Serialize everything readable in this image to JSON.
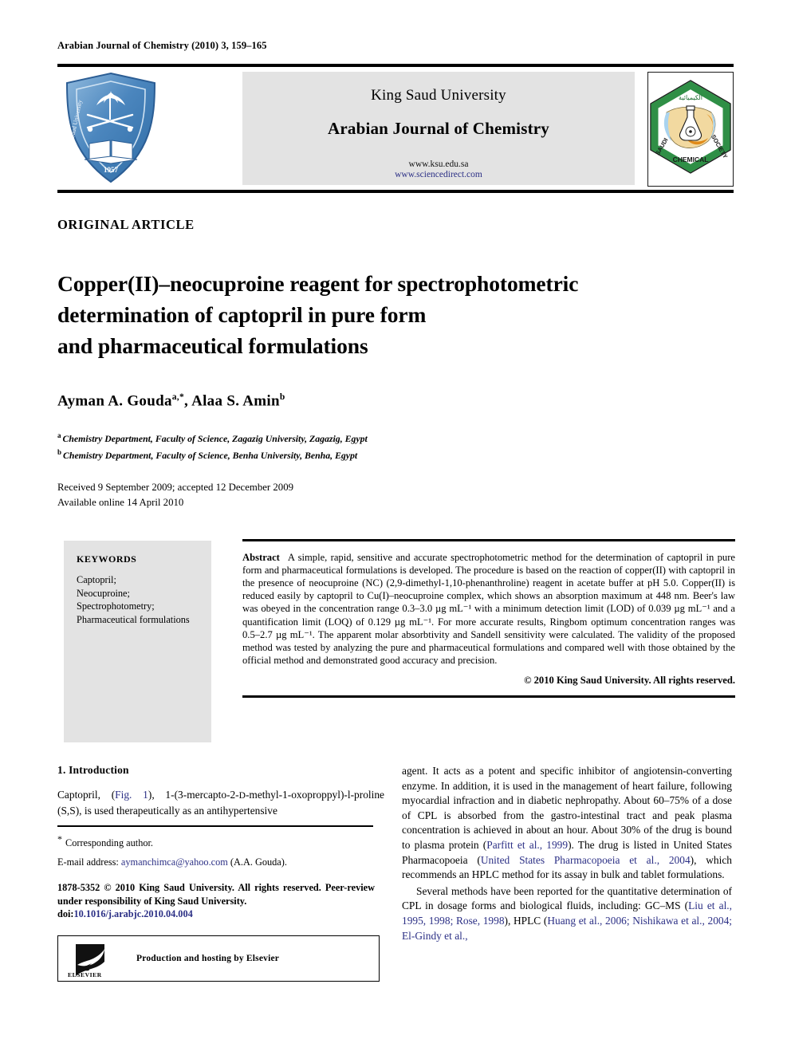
{
  "running_head": "Arabian Journal of Chemistry (2010) 3, 159–165",
  "masthead": {
    "publisher": "King Saud University",
    "journal": "Arabian Journal of Chemistry",
    "url_ksu": "www.ksu.edu.sa",
    "url_sciencedirect": "www.sciencedirect.com",
    "left_logo_name": "King Saud University",
    "left_logo_year": "1957",
    "right_logo_line1": "SAUDI",
    "right_logo_line2": "SOCIETY",
    "right_logo_line3": "CHEMICAL",
    "right_logo_arabic": "الكيميائية",
    "colors": {
      "panel_bg": "#e3e3e3",
      "ksu_blue": "#2f6fb5",
      "scs_green": "#2f8f46",
      "link_blue": "#2b2f85"
    }
  },
  "article_type": "ORIGINAL ARTICLE",
  "title": {
    "line1": "Copper(II)–neocuproine reagent for spectrophotometric",
    "line2": "determination of captopril in pure form",
    "line3": "and pharmaceutical formulations"
  },
  "authors": {
    "full": "Ayman A. Gouda",
    "marker1": "a,*",
    "second": ", Alaa S. Amin",
    "marker2": "b"
  },
  "affiliations": [
    {
      "marker": "a",
      "text": "Chemistry Department, Faculty of Science, Zagazig University, Zagazig, Egypt"
    },
    {
      "marker": "b",
      "text": "Chemistry Department, Faculty of Science, Benha University, Benha, Egypt"
    }
  ],
  "dates": {
    "received": "Received 9 September 2009; accepted 12 December 2009",
    "available": "Available online 14 April 2010"
  },
  "keywords": {
    "heading": "KEYWORDS",
    "items": "Captopril;\nNeocuproine;\nSpectrophotometry;\nPharmaceutical formulations"
  },
  "abstract": {
    "label": "Abstract",
    "text": "A simple, rapid, sensitive and accurate spectrophotometric method for the determination of captopril in pure form and pharmaceutical formulations is developed. The procedure is based on the reaction of copper(II) with captopril in the presence of neocuproine (NC) (2,9-dimethyl-1,10-phenanthroline) reagent in acetate buffer at pH 5.0. Copper(II) is reduced easily by captopril to Cu(I)–neocuproine complex, which shows an absorption maximum at 448 nm. Beer's law was obeyed in the concentration range 0.3–3.0 µg mL⁻¹ with a minimum detection limit (LOD) of 0.039 µg mL⁻¹ and a quantification limit (LOQ) of 0.129 µg mL⁻¹. For more accurate results, Ringbom optimum concentration ranges was 0.5–2.7 µg mL⁻¹. The apparent molar absorbtivity and Sandell sensitivity were calculated. The validity of the proposed method was tested by analyzing the pure and pharmaceutical formulations and compared well with those obtained by the official method and demonstrated good accuracy and precision.",
    "copyright": "© 2010 King Saud University. All rights reserved."
  },
  "body": {
    "section_heading": "1. Introduction",
    "left_para_1_pre": "Captopril, (",
    "left_para_1_link": "Fig. 1",
    "left_para_1_post": "), 1-(3-mercapto-2-",
    "left_para_1_smallcap": "D",
    "left_para_1_post2": "-methyl-1-oxoproppyl)-l-proline (S,S), is used therapeutically as an antihypertensive",
    "footnote_corresponding": "Corresponding author.",
    "footnote_email_label": "E-mail address:",
    "footnote_email": "aymanchimca@yahoo.com",
    "footnote_email_post": "(A.A. Gouda).",
    "issn_line": "1878-5352 © 2010 King Saud University. All rights reserved. Peer-review under responsibility of King Saud University.",
    "doi_label": "doi:",
    "doi_value": "10.1016/j.arabjc.2010.04.004",
    "elsevier_text": "Production and hosting by Elsevier",
    "elsevier_word": "ELSEVIER",
    "right_para_1": "agent. It acts as a potent and specific inhibitor of angiotensin-converting enzyme. In addition, it is used in the management of heart failure, following myocardial infraction and in diabetic nephropathy. About 60–75% of a dose of CPL is absorbed from the gastro-intestinal tract and peak plasma concentration is achieved in about an hour. About 30% of the drug is bound to plasma protein (",
    "right_cite_1": "Parfitt et al., 1999",
    "right_para_2": "). The drug is listed in United States Pharmacopoeia (",
    "right_cite_2": "United States Pharmacopoeia et al., 2004",
    "right_para_3": "), which recommends an HPLC method for its assay in bulk and tablet formulations.",
    "right_para_4": "Several methods have been reported for the quantitative determination of CPL in dosage forms and biological fluids, including: GC–MS (",
    "right_cite_3": "Liu et al., 1995, 1998; Rose, 1998",
    "right_para_5": "), HPLC (",
    "right_cite_4": "Huang et al., 2006; Nishikawa et al., 2004; El-Gindy et al.,"
  }
}
